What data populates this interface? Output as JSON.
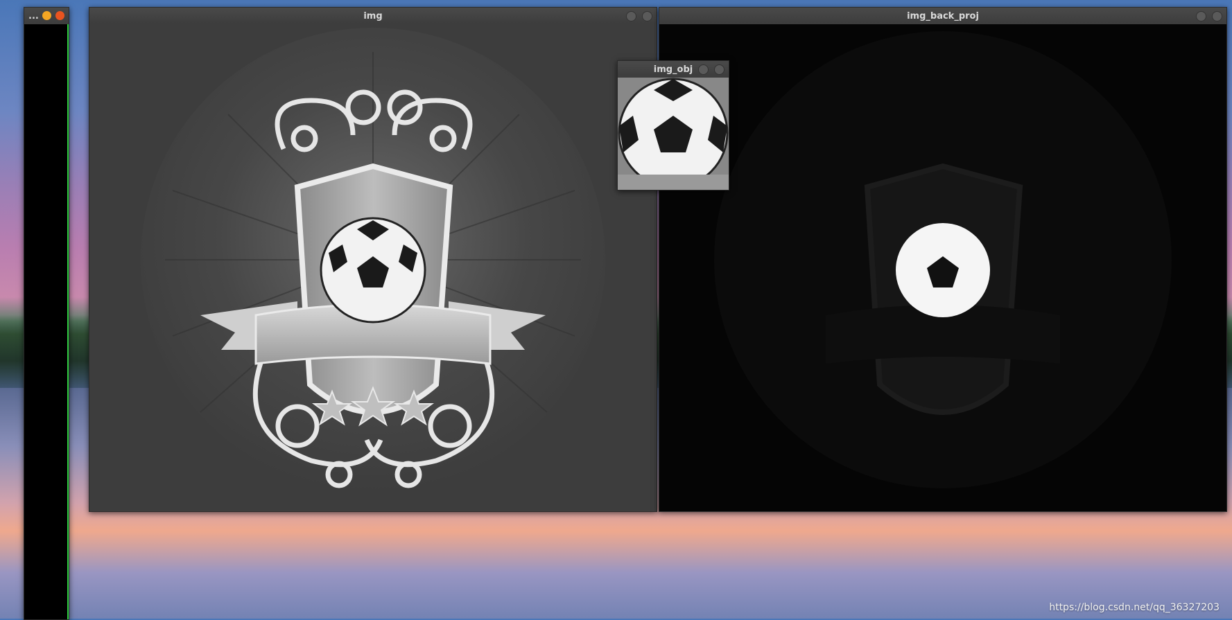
{
  "desktop": {
    "watermark": "https://blog.csdn.net/qq_36327203"
  },
  "windows": {
    "small_left": {
      "title": "...",
      "close_color": "#e95420",
      "min_color": "#f5a623"
    },
    "img": {
      "title": "img"
    },
    "img_obj": {
      "title": "img_obj"
    },
    "img_back_proj": {
      "title": "img_back_proj"
    }
  },
  "icons": [
    "close-icon",
    "minimize-icon",
    "soccer-ball-icon",
    "star-icon"
  ],
  "colors": {
    "window_bg": "#3b3b3b",
    "backproj_bg": "#050505",
    "accent_close": "#e95420",
    "accent_min": "#f5a623"
  }
}
